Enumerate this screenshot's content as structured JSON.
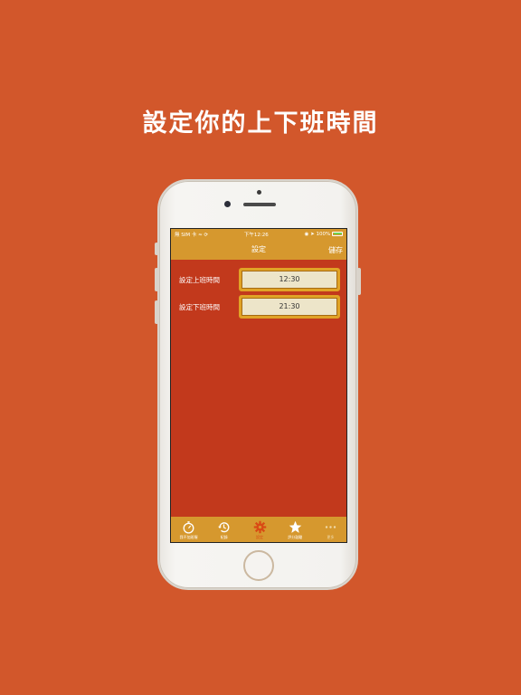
{
  "headline": "設定你的上下班時間",
  "status": {
    "carrier": "無 SIM 卡",
    "time": "下午12:26",
    "battery": "100%"
  },
  "nav": {
    "title": "設定",
    "save_label": "儲存"
  },
  "settings": {
    "start_label": "設定上班時間",
    "start_value": "12:30",
    "end_label": "設定下班時間",
    "end_value": "21:30"
  },
  "tabs": [
    {
      "label": "我不加班喔",
      "icon": "stopwatch-icon"
    },
    {
      "label": "紀錄",
      "icon": "history-icon"
    },
    {
      "label": "設定",
      "icon": "gear-icon"
    },
    {
      "label": "評分鼓勵",
      "icon": "star-icon"
    },
    {
      "label": "更多",
      "icon": "more-icon"
    }
  ],
  "colors": {
    "background": "#d2572b",
    "bar": "#d6982e",
    "screen": "#c2391c",
    "active_tab": "#d94a14"
  }
}
